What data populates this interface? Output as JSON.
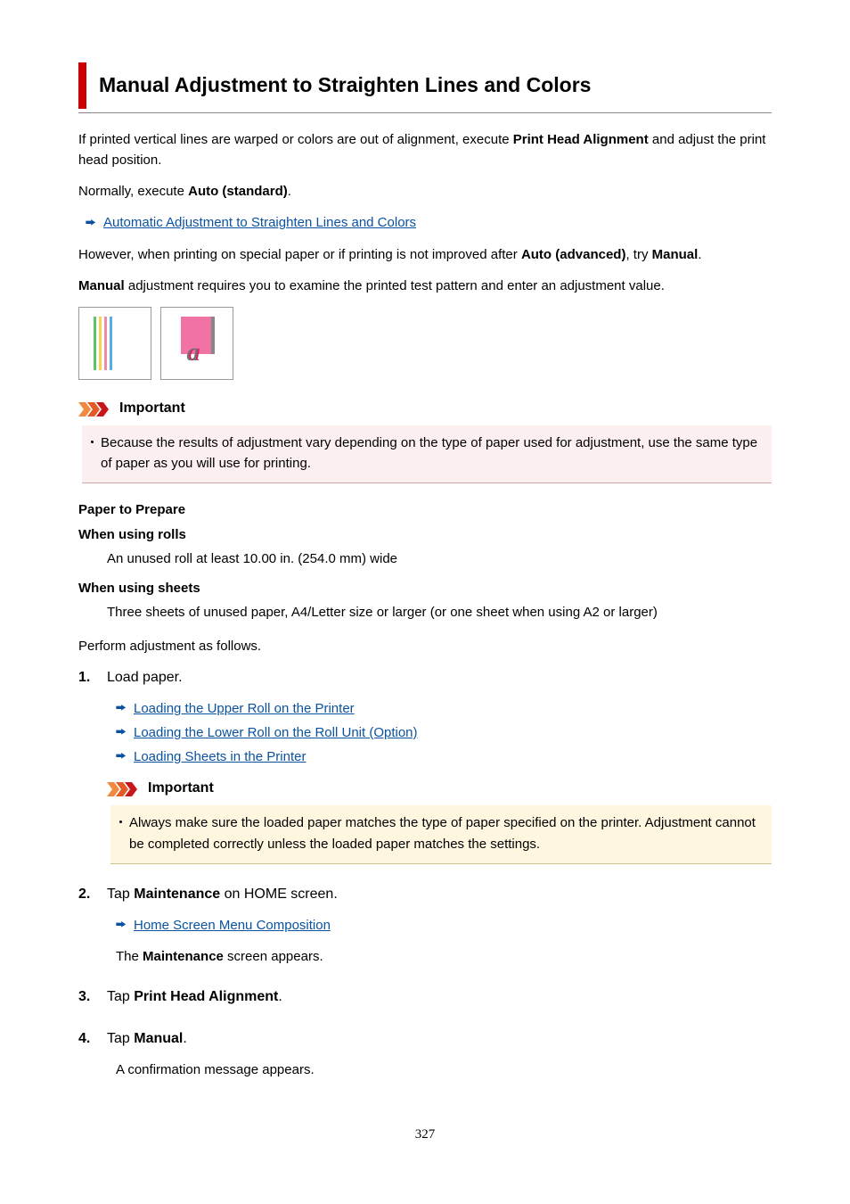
{
  "title": "Manual Adjustment to Straighten Lines and Colors",
  "intro1_a": "If printed vertical lines are warped or colors are out of alignment, execute ",
  "intro1_b": "Print Head Alignment",
  "intro1_c": " and adjust the print head position.",
  "intro2_a": "Normally, execute ",
  "intro2_b": "Auto (standard)",
  "intro2_c": ".",
  "link_auto": "Automatic Adjustment to Straighten Lines and Colors",
  "intro3_a": "However, when printing on special paper or if printing is not improved after ",
  "intro3_b": "Auto (advanced)",
  "intro3_c": ", try ",
  "intro3_d": "Manual",
  "intro3_e": ".",
  "intro4_a": "Manual",
  "intro4_b": " adjustment requires you to examine the printed test pattern and enter an adjustment value.",
  "important_label": "Important",
  "important1": "Because the results of adjustment vary depending on the type of paper used for adjustment, use the same type of paper as you will use for printing.",
  "prep_hd": "Paper to Prepare",
  "prep_rolls_t": "When using rolls",
  "prep_rolls_d": "An unused roll at least 10.00 in. (254.0 mm) wide",
  "prep_sheets_t": "When using sheets",
  "prep_sheets_d": "Three sheets of unused paper, A4/Letter size or larger (or one sheet when using A2 or larger)",
  "perform": "Perform adjustment as follows.",
  "step1": "Load paper.",
  "step1_l1": "Loading the Upper Roll on the Printer",
  "step1_l2": "Loading the Lower Roll on the Roll Unit (Option)",
  "step1_l3": "Loading Sheets in the Printer",
  "step1_imp": "Always make sure the loaded paper matches the type of paper specified on the printer. Adjustment cannot be completed correctly unless the loaded paper matches the settings.",
  "step2_a": "Tap ",
  "step2_b": "Maintenance",
  "step2_c": " on HOME screen.",
  "step2_l1": "Home Screen Menu Composition",
  "step2_body_a": "The ",
  "step2_body_b": "Maintenance",
  "step2_body_c": " screen appears.",
  "step3_a": "Tap ",
  "step3_b": "Print Head Alignment",
  "step3_c": ".",
  "step4_a": "Tap ",
  "step4_b": "Manual",
  "step4_c": ".",
  "step4_body": "A confirmation message appears.",
  "page": "327"
}
